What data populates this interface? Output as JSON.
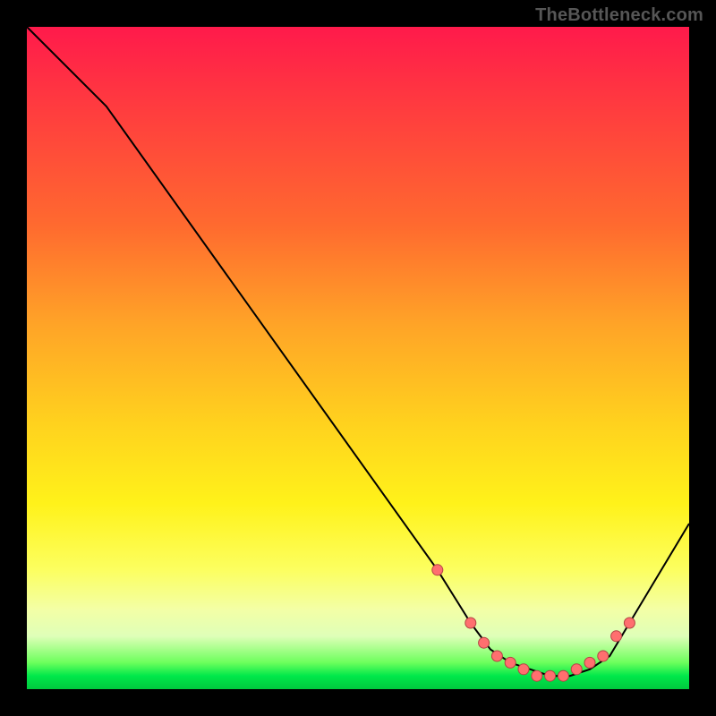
{
  "watermark": "TheBottleneck.com",
  "colors": {
    "frame": "#000000",
    "curve_stroke": "#000000",
    "marker_fill": "#ff6f6f",
    "marker_stroke": "#b24444"
  },
  "chart_data": {
    "type": "line",
    "title": "",
    "xlabel": "",
    "ylabel": "",
    "xlim": [
      0,
      100
    ],
    "ylim": [
      0,
      100
    ],
    "grid": false,
    "legend": "none",
    "series": [
      {
        "name": "curve",
        "x": [
          0,
          12,
          62,
          67,
          70,
          73,
          76,
          79,
          82,
          85,
          88,
          91,
          100
        ],
        "y": [
          100,
          88,
          18,
          10,
          6,
          4,
          3,
          2,
          2,
          3,
          5,
          10,
          25
        ]
      }
    ],
    "markers": {
      "name": "highlight-dots",
      "x": [
        62,
        67,
        69,
        71,
        73,
        75,
        77,
        79,
        81,
        83,
        85,
        87,
        89,
        91
      ],
      "y": [
        18,
        10,
        7,
        5,
        4,
        3,
        2,
        2,
        2,
        3,
        4,
        5,
        8,
        10
      ],
      "size": 6
    }
  }
}
